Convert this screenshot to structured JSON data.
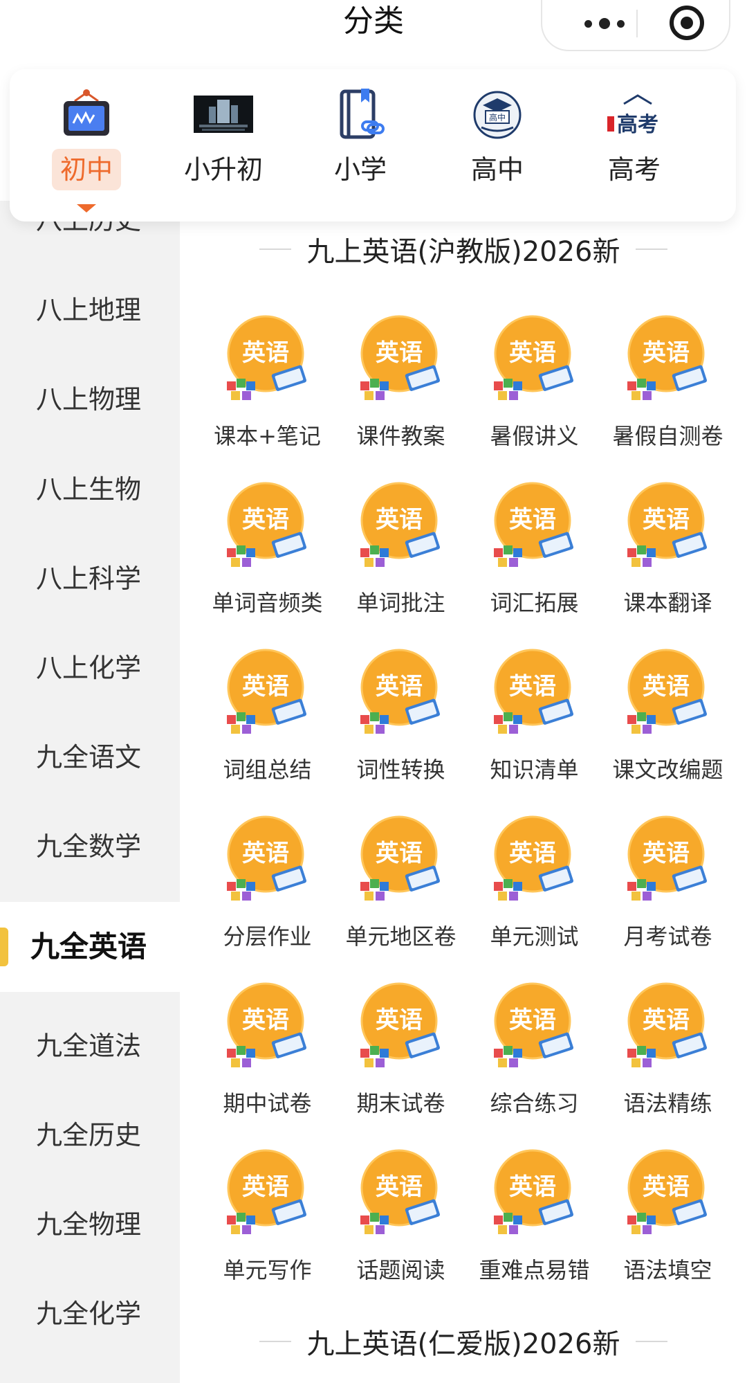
{
  "header": {
    "title": "分类"
  },
  "tabs": [
    {
      "label": "初中",
      "icon": "blackboard-icon",
      "active": true
    },
    {
      "label": "小升初",
      "icon": "study-photo-icon",
      "active": false
    },
    {
      "label": "小学",
      "icon": "book-link-icon",
      "active": false
    },
    {
      "label": "高中",
      "icon": "graduation-cap-badge-icon",
      "active": false
    },
    {
      "label": "高考",
      "icon": "gaokao-text-icon",
      "active": false
    }
  ],
  "sidebar": {
    "items": [
      {
        "label": "八上历史",
        "active": false
      },
      {
        "label": "八上地理",
        "active": false
      },
      {
        "label": "八上物理",
        "active": false
      },
      {
        "label": "八上生物",
        "active": false
      },
      {
        "label": "八上科学",
        "active": false
      },
      {
        "label": "八上化学",
        "active": false
      },
      {
        "label": "九全语文",
        "active": false
      },
      {
        "label": "九全数学",
        "active": false
      },
      {
        "label": "九全英语",
        "active": true
      },
      {
        "label": "九全道法",
        "active": false
      },
      {
        "label": "九全历史",
        "active": false
      },
      {
        "label": "九全物理",
        "active": false
      },
      {
        "label": "九全化学",
        "active": false
      }
    ]
  },
  "sections": [
    {
      "title": "九上英语(沪教版)2026新",
      "items": [
        {
          "label": "课本+笔记"
        },
        {
          "label": "课件教案"
        },
        {
          "label": "暑假讲义"
        },
        {
          "label": "暑假自测卷"
        },
        {
          "label": "单词音频类"
        },
        {
          "label": "单词批注"
        },
        {
          "label": "词汇拓展"
        },
        {
          "label": "课本翻译"
        },
        {
          "label": "词组总结"
        },
        {
          "label": "词性转换"
        },
        {
          "label": "知识清单"
        },
        {
          "label": "课文改编题"
        },
        {
          "label": "分层作业"
        },
        {
          "label": "单元地区卷"
        },
        {
          "label": "单元测试"
        },
        {
          "label": "月考试卷"
        },
        {
          "label": "期中试卷"
        },
        {
          "label": "期末试卷"
        },
        {
          "label": "综合练习"
        },
        {
          "label": "语法精练"
        },
        {
          "label": "单元写作"
        },
        {
          "label": "话题阅读"
        },
        {
          "label": "重难点易错"
        },
        {
          "label": "语法填空"
        }
      ]
    },
    {
      "title": "九上英语(仁爱版)2026新",
      "items": []
    }
  ],
  "icon_badge_text": "英语",
  "icon_text": {
    "gaokao": "高考",
    "gaozhong": "高中"
  },
  "colors": {
    "accent": "#ee6a2c",
    "accent_bg": "#fbe4d8",
    "sidebar_bg": "#f2f2f2",
    "sidebar_marker": "#f2c23e",
    "english_badge": "#f7a92a"
  }
}
